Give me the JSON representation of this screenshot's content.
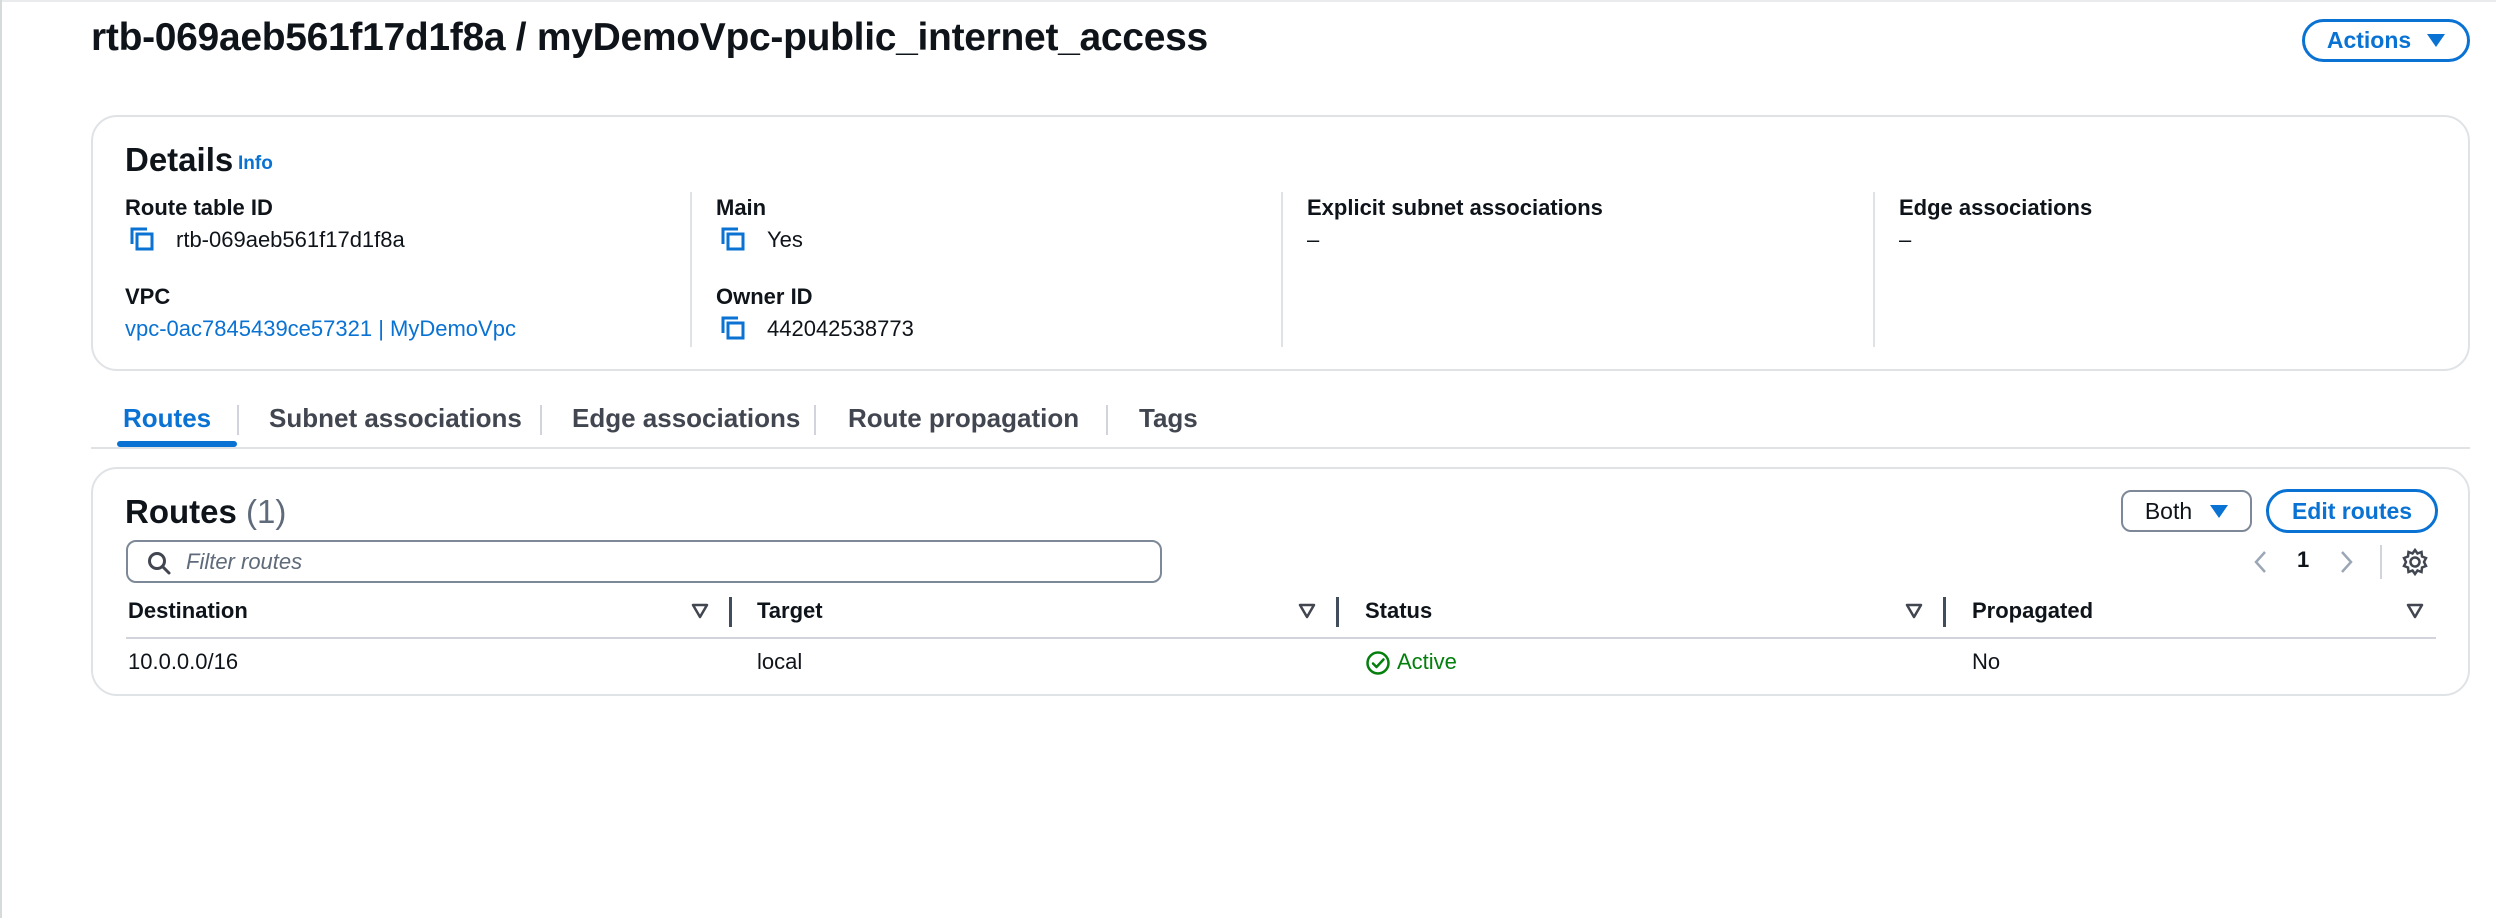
{
  "header": {
    "title": "rtb-069aeb561f17d1f8a / myDemoVpc-public_internet_access",
    "actions_label": "Actions"
  },
  "details": {
    "title": "Details",
    "info_label": "Info",
    "route_table_id_label": "Route table ID",
    "route_table_id_value": "rtb-069aeb561f17d1f8a",
    "vpc_label": "VPC",
    "vpc_value": "vpc-0ac7845439ce57321 | MyDemoVpc",
    "main_label": "Main",
    "main_value": "Yes",
    "owner_id_label": "Owner ID",
    "owner_id_value": "442042538773",
    "explicit_subnet_label": "Explicit subnet associations",
    "explicit_subnet_value": "–",
    "edge_assoc_label": "Edge associations",
    "edge_assoc_value": "–"
  },
  "tabs": [
    {
      "label": "Routes",
      "active": true
    },
    {
      "label": "Subnet associations",
      "active": false
    },
    {
      "label": "Edge associations",
      "active": false
    },
    {
      "label": "Route propagation",
      "active": false
    },
    {
      "label": "Tags",
      "active": false
    }
  ],
  "routes": {
    "title": "Routes",
    "count": "(1)",
    "both_label": "Both",
    "edit_label": "Edit routes",
    "filter_placeholder": "Filter routes",
    "page": "1",
    "columns": [
      "Destination",
      "Target",
      "Status",
      "Propagated"
    ],
    "rows": [
      {
        "destination": "10.0.0.0/16",
        "target": "local",
        "status": "Active",
        "propagated": "No"
      }
    ]
  },
  "colors": {
    "accent": "#0972d3",
    "success": "#037f0c",
    "text": "#0f141a",
    "border": "#e0e3e6"
  }
}
